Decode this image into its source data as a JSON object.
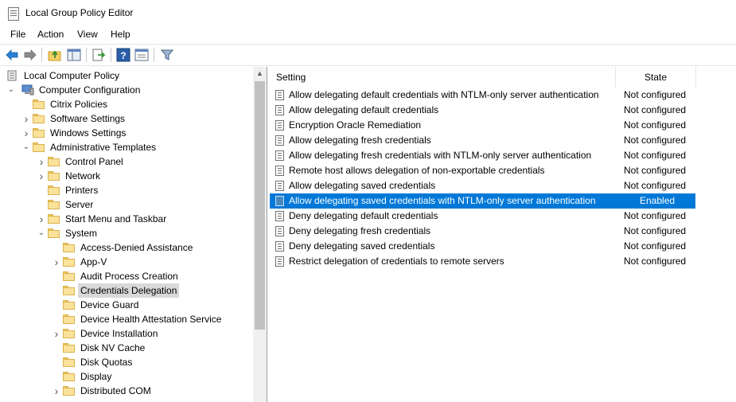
{
  "window": {
    "title": "Local Group Policy Editor"
  },
  "menu": [
    "File",
    "Action",
    "View",
    "Help"
  ],
  "toolbar": {
    "icons": [
      "back-arrow-icon",
      "forward-arrow-icon",
      "up-folder-icon",
      "show-hide-tree-icon",
      "export-list-icon",
      "help-icon",
      "properties-icon",
      "filter-icon"
    ]
  },
  "tree": {
    "items": [
      {
        "label": "Local Computer Policy",
        "level": 0,
        "chevron": "",
        "icon": "policy"
      },
      {
        "label": "Computer Configuration",
        "level": 0,
        "chevron": "down",
        "icon": "computer"
      },
      {
        "label": "Citrix Policies",
        "level": 1,
        "chevron": "",
        "icon": "folder"
      },
      {
        "label": "Software Settings",
        "level": 1,
        "chevron": "right",
        "icon": "folder"
      },
      {
        "label": "Windows Settings",
        "level": 1,
        "chevron": "right",
        "icon": "folder"
      },
      {
        "label": "Administrative Templates",
        "level": 1,
        "chevron": "down",
        "icon": "folder"
      },
      {
        "label": "Control Panel",
        "level": 2,
        "chevron": "right",
        "icon": "folder"
      },
      {
        "label": "Network",
        "level": 2,
        "chevron": "right",
        "icon": "folder"
      },
      {
        "label": "Printers",
        "level": 2,
        "chevron": "",
        "icon": "folder"
      },
      {
        "label": "Server",
        "level": 2,
        "chevron": "",
        "icon": "folder"
      },
      {
        "label": "Start Menu and Taskbar",
        "level": 2,
        "chevron": "right",
        "icon": "folder"
      },
      {
        "label": "System",
        "level": 2,
        "chevron": "down",
        "icon": "folder"
      },
      {
        "label": "Access-Denied Assistance",
        "level": 3,
        "chevron": "",
        "icon": "folder"
      },
      {
        "label": "App-V",
        "level": 3,
        "chevron": "right",
        "icon": "folder"
      },
      {
        "label": "Audit Process Creation",
        "level": 3,
        "chevron": "",
        "icon": "folder"
      },
      {
        "label": "Credentials Delegation",
        "level": 3,
        "chevron": "",
        "icon": "folder",
        "selected": true
      },
      {
        "label": "Device Guard",
        "level": 3,
        "chevron": "",
        "icon": "folder"
      },
      {
        "label": "Device Health Attestation Service",
        "level": 3,
        "chevron": "",
        "icon": "folder"
      },
      {
        "label": "Device Installation",
        "level": 3,
        "chevron": "right",
        "icon": "folder"
      },
      {
        "label": "Disk NV Cache",
        "level": 3,
        "chevron": "",
        "icon": "folder"
      },
      {
        "label": "Disk Quotas",
        "level": 3,
        "chevron": "",
        "icon": "folder"
      },
      {
        "label": "Display",
        "level": 3,
        "chevron": "",
        "icon": "folder"
      },
      {
        "label": "Distributed COM",
        "level": 3,
        "chevron": "right",
        "icon": "folder"
      }
    ]
  },
  "list": {
    "columns": {
      "setting": "Setting",
      "state": "State"
    },
    "rows": [
      {
        "setting": "Allow delegating default credentials with NTLM-only server authentication",
        "state": "Not configured"
      },
      {
        "setting": "Allow delegating default credentials",
        "state": "Not configured"
      },
      {
        "setting": "Encryption Oracle Remediation",
        "state": "Not configured"
      },
      {
        "setting": "Allow delegating fresh credentials",
        "state": "Not configured"
      },
      {
        "setting": "Allow delegating fresh credentials with NTLM-only server authentication",
        "state": "Not configured"
      },
      {
        "setting": "Remote host allows delegation of non-exportable credentials",
        "state": "Not configured"
      },
      {
        "setting": "Allow delegating saved credentials",
        "state": "Not configured"
      },
      {
        "setting": "Allow delegating saved credentials with NTLM-only server authentication",
        "state": "Enabled",
        "selected": true
      },
      {
        "setting": "Deny delegating default credentials",
        "state": "Not configured"
      },
      {
        "setting": "Deny delegating fresh credentials",
        "state": "Not configured"
      },
      {
        "setting": "Deny delegating saved credentials",
        "state": "Not configured"
      },
      {
        "setting": "Restrict delegation of credentials to remote servers",
        "state": "Not configured"
      }
    ]
  },
  "colors": {
    "selection": "#0078d7",
    "tree_selection": "#d9d9d9",
    "folder": "#fbe29b"
  }
}
